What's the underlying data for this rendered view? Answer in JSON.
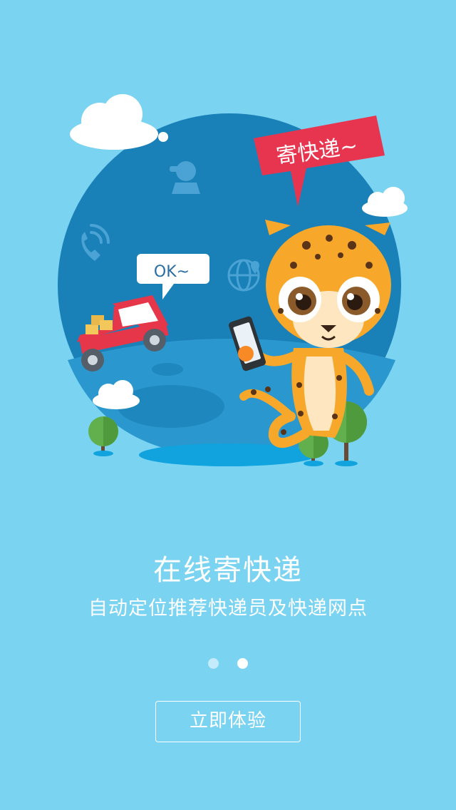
{
  "illustration": {
    "speech_bubble_main": "寄快递~",
    "speech_bubble_ok": "OK~",
    "icons": [
      "courier-icon",
      "phone-icon",
      "globe-location-icon"
    ],
    "colors": {
      "background": "#7ad3f1",
      "globe": "#1a80b8",
      "bubble_red": "#e8354f",
      "truck_red": "#e5364a",
      "leopard": "#f7a82a"
    }
  },
  "onboarding": {
    "title": "在线寄快递",
    "subtitle": "自动定位推荐快递员及快递网点",
    "pages": [
      {
        "active": false
      },
      {
        "active": true
      }
    ],
    "start_button": "立即体验"
  }
}
